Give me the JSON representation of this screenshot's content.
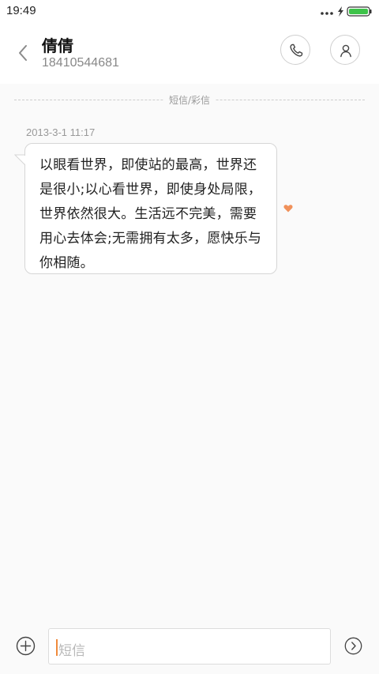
{
  "status_bar": {
    "time": "19:49"
  },
  "header": {
    "contact_name": "倩倩",
    "contact_number": "18410544681"
  },
  "thread": {
    "divider_label": "短信/彩信",
    "messages": [
      {
        "timestamp": "2013-3-1 11:17",
        "text": "以眼看世界，即使站的最高，世界还是很小;以心看世界，即使身处局限，世界依然很大。生活远不完美，需要用心去体会;无需拥有太多，愿快乐与你相随。",
        "favorited": true
      }
    ]
  },
  "composer": {
    "placeholder": "短信"
  },
  "colors": {
    "accent": "#f08a3c",
    "favorite": "#f0915a",
    "battery": "#3ec34a",
    "bubble_border": "#d6d6d6",
    "background": "#fafafa"
  },
  "icons": {
    "back": "chevron-left-icon",
    "call": "phone-icon",
    "profile": "person-icon",
    "favorite": "heart-icon",
    "add": "plus-circle-icon",
    "send": "arrow-right-circle-icon",
    "signal": "more-dots-icon",
    "charging": "lightning-icon",
    "battery": "battery-icon"
  }
}
